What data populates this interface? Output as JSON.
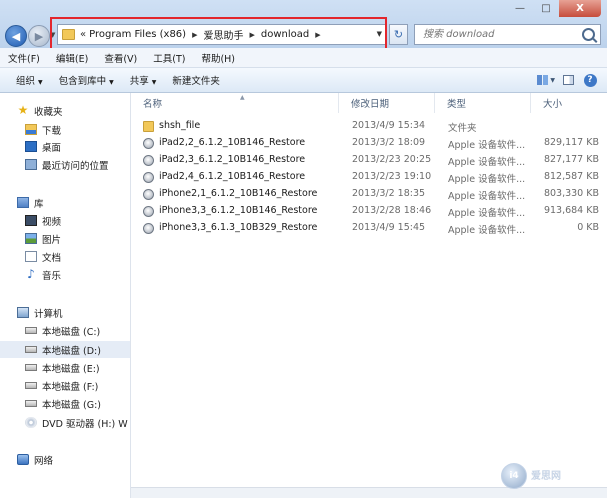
{
  "window": {
    "minimize": "—",
    "maximize": "□",
    "close": "X"
  },
  "address_bar": {
    "overflow": "«",
    "crumbs": [
      "Program Files (x86)",
      "爱思助手",
      "download"
    ]
  },
  "search": {
    "placeholder": "搜索 download"
  },
  "menu": [
    "文件(F)",
    "编辑(E)",
    "查看(V)",
    "工具(T)",
    "帮助(H)"
  ],
  "toolbar": {
    "organize": "组织",
    "include_library": "包含到库中",
    "share": "共享",
    "new_folder": "新建文件夹"
  },
  "sidebar": {
    "favorites_label": "收藏夹",
    "favorites": [
      "下载",
      "桌面",
      "最近访问的位置"
    ],
    "library_label": "库",
    "libraries": [
      "视频",
      "图片",
      "文档",
      "音乐"
    ],
    "computer_label": "计算机",
    "drives": [
      "本地磁盘 (C:)",
      "本地磁盘 (D:)",
      "本地磁盘 (E:)",
      "本地磁盘 (F:)",
      "本地磁盘 (G:)",
      "DVD 驱动器 (H:) W"
    ],
    "network_label": "网络"
  },
  "columns": {
    "name": "名称",
    "date": "修改日期",
    "type": "类型",
    "size": "大小"
  },
  "files": [
    {
      "name": "shsh_file",
      "date": "2013/4/9 15:34",
      "type": "文件夹",
      "size": "",
      "icon": "folder"
    },
    {
      "name": "iPad2,2_6.1.2_10B146_Restore",
      "date": "2013/3/2 18:09",
      "type": "Apple 设备软件...",
      "size": "829,117 KB",
      "icon": "ipsw"
    },
    {
      "name": "iPad2,3_6.1.2_10B146_Restore",
      "date": "2013/2/23 20:25",
      "type": "Apple 设备软件...",
      "size": "827,177 KB",
      "icon": "ipsw"
    },
    {
      "name": "iPad2,4_6.1.2_10B146_Restore",
      "date": "2013/2/23 19:10",
      "type": "Apple 设备软件...",
      "size": "812,587 KB",
      "icon": "ipsw"
    },
    {
      "name": "iPhone2,1_6.1.2_10B146_Restore",
      "date": "2013/3/2 18:35",
      "type": "Apple 设备软件...",
      "size": "803,330 KB",
      "icon": "ipsw"
    },
    {
      "name": "iPhone3,3_6.1.2_10B146_Restore",
      "date": "2013/2/28 18:46",
      "type": "Apple 设备软件...",
      "size": "913,684 KB",
      "icon": "ipsw"
    },
    {
      "name": "iPhone3,3_6.1.3_10B329_Restore",
      "date": "2013/4/9 15:45",
      "type": "Apple 设备软件...",
      "size": "0 KB",
      "icon": "ipsw"
    }
  ],
  "watermark": {
    "logo": "i4",
    "text": "爱思网"
  },
  "colors": {
    "highlight_box": "#e3262d",
    "selection": "#e5ecf6"
  }
}
